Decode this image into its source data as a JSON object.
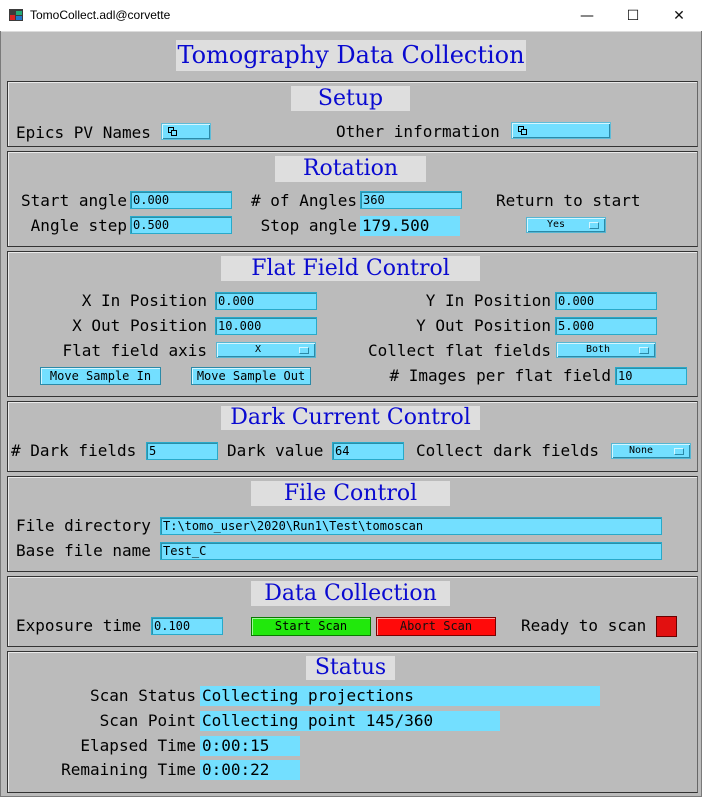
{
  "window": {
    "title": "TomoCollect.adl@corvette",
    "min_symbol": "—",
    "max_symbol": "☐",
    "close_symbol": "✕"
  },
  "main_title": "Tomography Data Collection",
  "setup": {
    "title": "Setup",
    "epics_label": "Epics PV Names",
    "other_label": "Other information"
  },
  "rotation": {
    "title": "Rotation",
    "start_angle_label": "Start angle",
    "start_angle": "0.000",
    "angle_step_label": "Angle step",
    "angle_step": "0.500",
    "num_angles_label": "# of Angles",
    "num_angles": "360",
    "stop_angle_label": "Stop angle",
    "stop_angle": "179.500",
    "return_label": "Return to start",
    "return_value": "Yes"
  },
  "flat_field": {
    "title": "Flat Field Control",
    "x_in_label": "X In Position",
    "x_in": "0.000",
    "x_out_label": "X Out Position",
    "x_out": "10.000",
    "axis_label": "Flat field axis",
    "axis_value": "X",
    "y_in_label": "Y In Position",
    "y_in": "0.000",
    "y_out_label": "Y Out Position",
    "y_out": "5.000",
    "collect_label": "Collect flat fields",
    "collect_value": "Both",
    "move_in_btn": "Move Sample In",
    "move_out_btn": "Move Sample Out",
    "images_label": "# Images per flat field",
    "images_value": "10"
  },
  "dark": {
    "title": "Dark Current Control",
    "num_label": "# Dark fields",
    "num_value": "5",
    "value_label": "Dark value",
    "value": "64",
    "collect_label": "Collect dark fields",
    "collect_value": "None"
  },
  "file": {
    "title": "File Control",
    "dir_label": "File directory",
    "dir_value": "T:\\tomo_user\\2020\\Run1\\Test\\tomoscan",
    "base_label": "Base file name",
    "base_value": "Test_C"
  },
  "collection": {
    "title": "Data Collection",
    "exposure_label": "Exposure time",
    "exposure_value": "0.100",
    "start_btn": "Start Scan",
    "abort_btn": "Abort Scan",
    "ready_label": "Ready to scan",
    "ready_color": "#e21010"
  },
  "status": {
    "title": "Status",
    "scan_status_label": "Scan Status",
    "scan_status": "Collecting projections",
    "scan_point_label": "Scan Point",
    "scan_point": "Collecting point 145/360",
    "elapsed_label": "Elapsed Time",
    "elapsed": "0:00:15",
    "remaining_label": "Remaining Time",
    "remaining": "0:00:22"
  },
  "colors": {
    "background": "#bbbbbb",
    "title_text": "#0a0ad0",
    "field": "#73dfff",
    "start_button": "#21e80c",
    "abort_button": "#ff0a0a"
  },
  "icons": {
    "app": "medm-app-icon",
    "related_display": "related-display-icon",
    "menu_caret": "menu-caret-icon"
  }
}
